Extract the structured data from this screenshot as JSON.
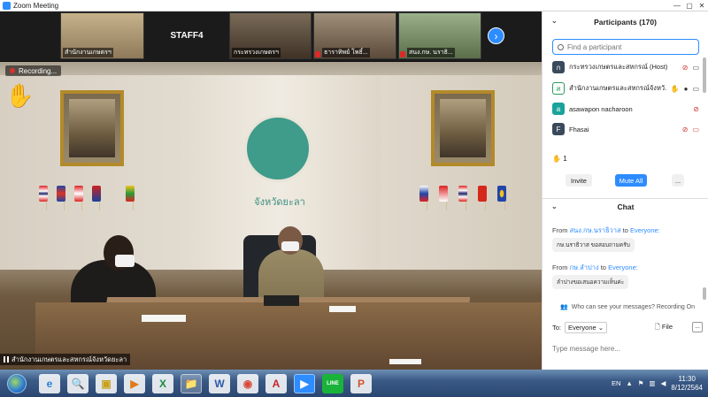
{
  "window": {
    "title": "Zoom Meeting",
    "minimize": "—",
    "maximize": "▢",
    "close": "✕"
  },
  "filmstrip": {
    "tiles": [
      {
        "name": "สำนักงานเกษตรฯ"
      },
      {
        "name": "STAFF4"
      },
      {
        "name": "กระทรวงเกษตรฯ"
      },
      {
        "name": "ธาราทิพย์ โพธิ์..."
      },
      {
        "name": "สนง.กษ. นราธิ..."
      }
    ],
    "next_icon": "›"
  },
  "main_video": {
    "recording_label": "Recording...",
    "raised_hand": "✋",
    "wall_text": "จังหวัดยะลา",
    "speaker_name": "สำนักงานเกษตรและสหกรณ์จังหวัดยะลา"
  },
  "participants": {
    "header": "Participants (170)",
    "search_placeholder": "Find a participant",
    "list": [
      {
        "initial": "ก",
        "name": "กระทรวงเกษตรและสหกรณ์ (Host)",
        "color": "#3a4a5c",
        "icons": [
          "🎤",
          "📹"
        ]
      },
      {
        "initial": "ส",
        "name": "สำนักงานเกษตรและสหกรณ์จังหวั...",
        "color": "#ffffff",
        "icons": [
          "✋",
          "🎤",
          "📹"
        ]
      },
      {
        "initial": "a",
        "name": "asawapon nacharoon",
        "color": "#1aa39b",
        "icons": [
          "🎤"
        ]
      },
      {
        "initial": "F",
        "name": "Fhasai",
        "color": "#3a4a5c",
        "icons": [
          "🎤",
          "📹"
        ]
      }
    ],
    "raised_hands": "1",
    "invite_label": "Invite",
    "mute_all_label": "Mute All",
    "more_label": "..."
  },
  "chat": {
    "header": "Chat",
    "messages": [
      {
        "from_prefix": "From",
        "from": "สนง.กษ.นราธิวาส",
        "to_prefix": "to",
        "to": "Everyone:",
        "text": "กษ.นราธิวาส ขอสอบถามครับ"
      },
      {
        "from_prefix": "From",
        "from": "กษ.ลำปาง",
        "to_prefix": "to",
        "to": "Everyone:",
        "text": "ลำปางขอเสนอความเห็นค่ะ"
      }
    ],
    "visibility_note": "Who can see your messages? Recording On",
    "to_label": "To:",
    "to_value": "Everyone",
    "file_label": "File",
    "more_label": "...",
    "input_placeholder": "Type message here..."
  },
  "taskbar": {
    "apps": [
      {
        "name": "ie",
        "glyph": "e",
        "color": "#2a7fd4"
      },
      {
        "name": "search",
        "glyph": "🔍",
        "color": "#2a8a5a"
      },
      {
        "name": "box",
        "glyph": "▣",
        "color": "#c8a21e"
      },
      {
        "name": "media",
        "glyph": "▶",
        "color": "#e07a18"
      },
      {
        "name": "excel",
        "glyph": "X",
        "color": "#1f8a44"
      },
      {
        "name": "folder",
        "glyph": "📁",
        "color": "#e6b84a"
      },
      {
        "name": "word",
        "glyph": "W",
        "color": "#2b5aa8"
      },
      {
        "name": "chrome",
        "glyph": "◉",
        "color": "#d94a3a"
      },
      {
        "name": "acrobat",
        "glyph": "A",
        "color": "#c0272d"
      },
      {
        "name": "zoom",
        "glyph": "▶",
        "color": "#2d8cff"
      },
      {
        "name": "line",
        "glyph": "LINE",
        "color": "#19b33a"
      },
      {
        "name": "powerpoint",
        "glyph": "P",
        "color": "#d1532b"
      }
    ],
    "lang": "EN",
    "time": "11:30",
    "date": "8/12/2564"
  }
}
